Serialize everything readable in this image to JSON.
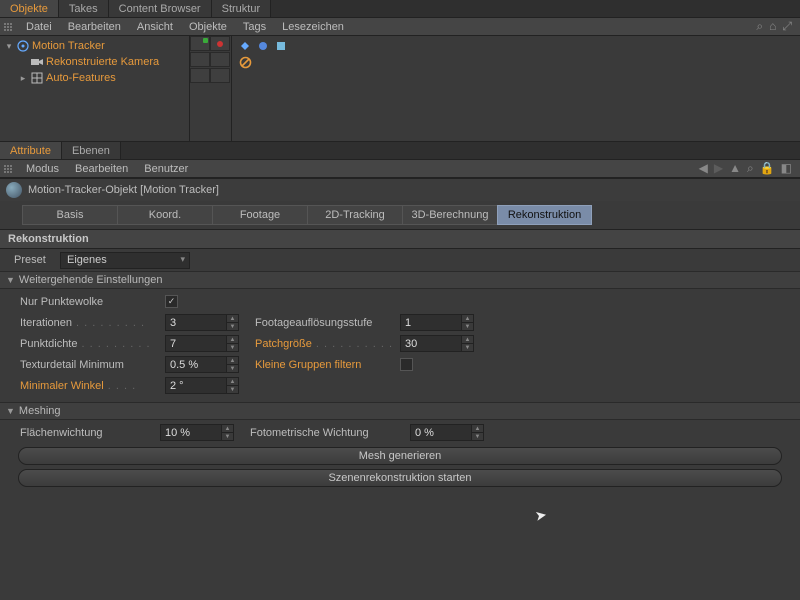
{
  "topTabs": {
    "t0": "Objekte",
    "t1": "Takes",
    "t2": "Content Browser",
    "t3": "Struktur"
  },
  "topMenu": {
    "m0": "Datei",
    "m1": "Bearbeiten",
    "m2": "Ansicht",
    "m3": "Objekte",
    "m4": "Tags",
    "m5": "Lesezeichen"
  },
  "tree": {
    "n0": "Motion Tracker",
    "n1": "Rekonstruierte Kamera",
    "n2": "Auto-Features"
  },
  "attrTabs": {
    "t0": "Attribute",
    "t1": "Ebenen"
  },
  "attrMenu": {
    "m0": "Modus",
    "m1": "Bearbeiten",
    "m2": "Benutzer"
  },
  "objTitle": "Motion-Tracker-Objekt [Motion Tracker]",
  "propTabs": {
    "p0": "Basis",
    "p1": "Koord.",
    "p2": "Footage",
    "p3": "2D-Tracking",
    "p4": "3D-Berechnung",
    "p5": "Rekonstruktion"
  },
  "section1": "Rekonstruktion",
  "presetLbl": "Preset",
  "presetVal": "Eigenes",
  "group1": "Weitergehende Einstellungen",
  "g1": {
    "nurPunkte": "Nur Punktewolke",
    "iter": "Iterationen",
    "iterV": "3",
    "footRes": "Footageauflösungsstufe",
    "footResV": "1",
    "punkt": "Punktdichte",
    "punktV": "7",
    "patch": "Patchgröße",
    "patchV": "30",
    "texMin": "Texturdetail Minimum",
    "texMinV": "0.5 %",
    "kleine": "Kleine Gruppen filtern",
    "minW": "Minimaler Winkel",
    "minWV": "2 °"
  },
  "group2": "Meshing",
  "g2": {
    "flw": "Flächenwichtung",
    "flwV": "10 %",
    "foto": "Fotometrische Wichtung",
    "fotoV": "0 %"
  },
  "btn1": "Mesh generieren",
  "btn2": "Szenenrekonstruktion starten"
}
